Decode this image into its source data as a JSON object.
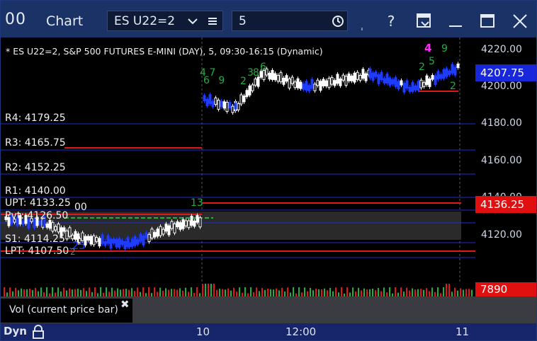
{
  "titlebar": {
    "logo": "00",
    "title": "Chart",
    "symbol": "ES U22=2",
    "interval": "5",
    "icons": [
      "chevron-down-icon",
      "list-icon",
      "clock-icon",
      "pin-icon",
      "help-icon",
      "link-dropdown-icon",
      "minimize-icon",
      "maximize-icon",
      "close-icon"
    ],
    "help": "?"
  },
  "chart": {
    "header": "* ES U22=2, S&P 500 FUTURES E-MINI (DAY), 5, 09:30-16:15 (Dynamic)",
    "levels": {
      "r4": "R4: 4179.25",
      "r3": "R3: 4165.75",
      "r2": "R2: 4152.25",
      "r1": "R1: 4140.00",
      "upt": "UPT: 4133.25",
      "pvt": "Pvt: 4126.50",
      "s1": "S1: 4114.25",
      "lpt": "LPT: 4107.50",
      "stub_00": "00",
      "stub_25": ".25",
      "stub_2": "2"
    },
    "counts": {
      "a": "4 7",
      "b": "6 9",
      "c": "2",
      "d": "3",
      "e": "6",
      "f": "8",
      "g": "13",
      "h": "4",
      "i": "9",
      "j": "2",
      "k": "5",
      "l": "2"
    },
    "axis": {
      "ticks": [
        "4220.00",
        "4200.00",
        "4180.00",
        "4160.00",
        "4140.00",
        "4120.00"
      ],
      "last_price": "4207.75",
      "pivot_price": "4136.25",
      "volume": "7890"
    },
    "time_axis": [
      "10",
      "12:00",
      "11"
    ],
    "colors": {
      "bg": "#000000",
      "up": "#ffffff",
      "down": "#1e3cff",
      "res": "#1e2fd0",
      "red": "#e01818",
      "green": "#20b040",
      "magenta": "#ff2cff",
      "tag_blue": "#1727d9",
      "tag_red": "#e01010"
    }
  },
  "volume_panel": {
    "label": "Vol (current price bar)"
  },
  "bottom": {
    "dyn": "Dyn"
  }
}
